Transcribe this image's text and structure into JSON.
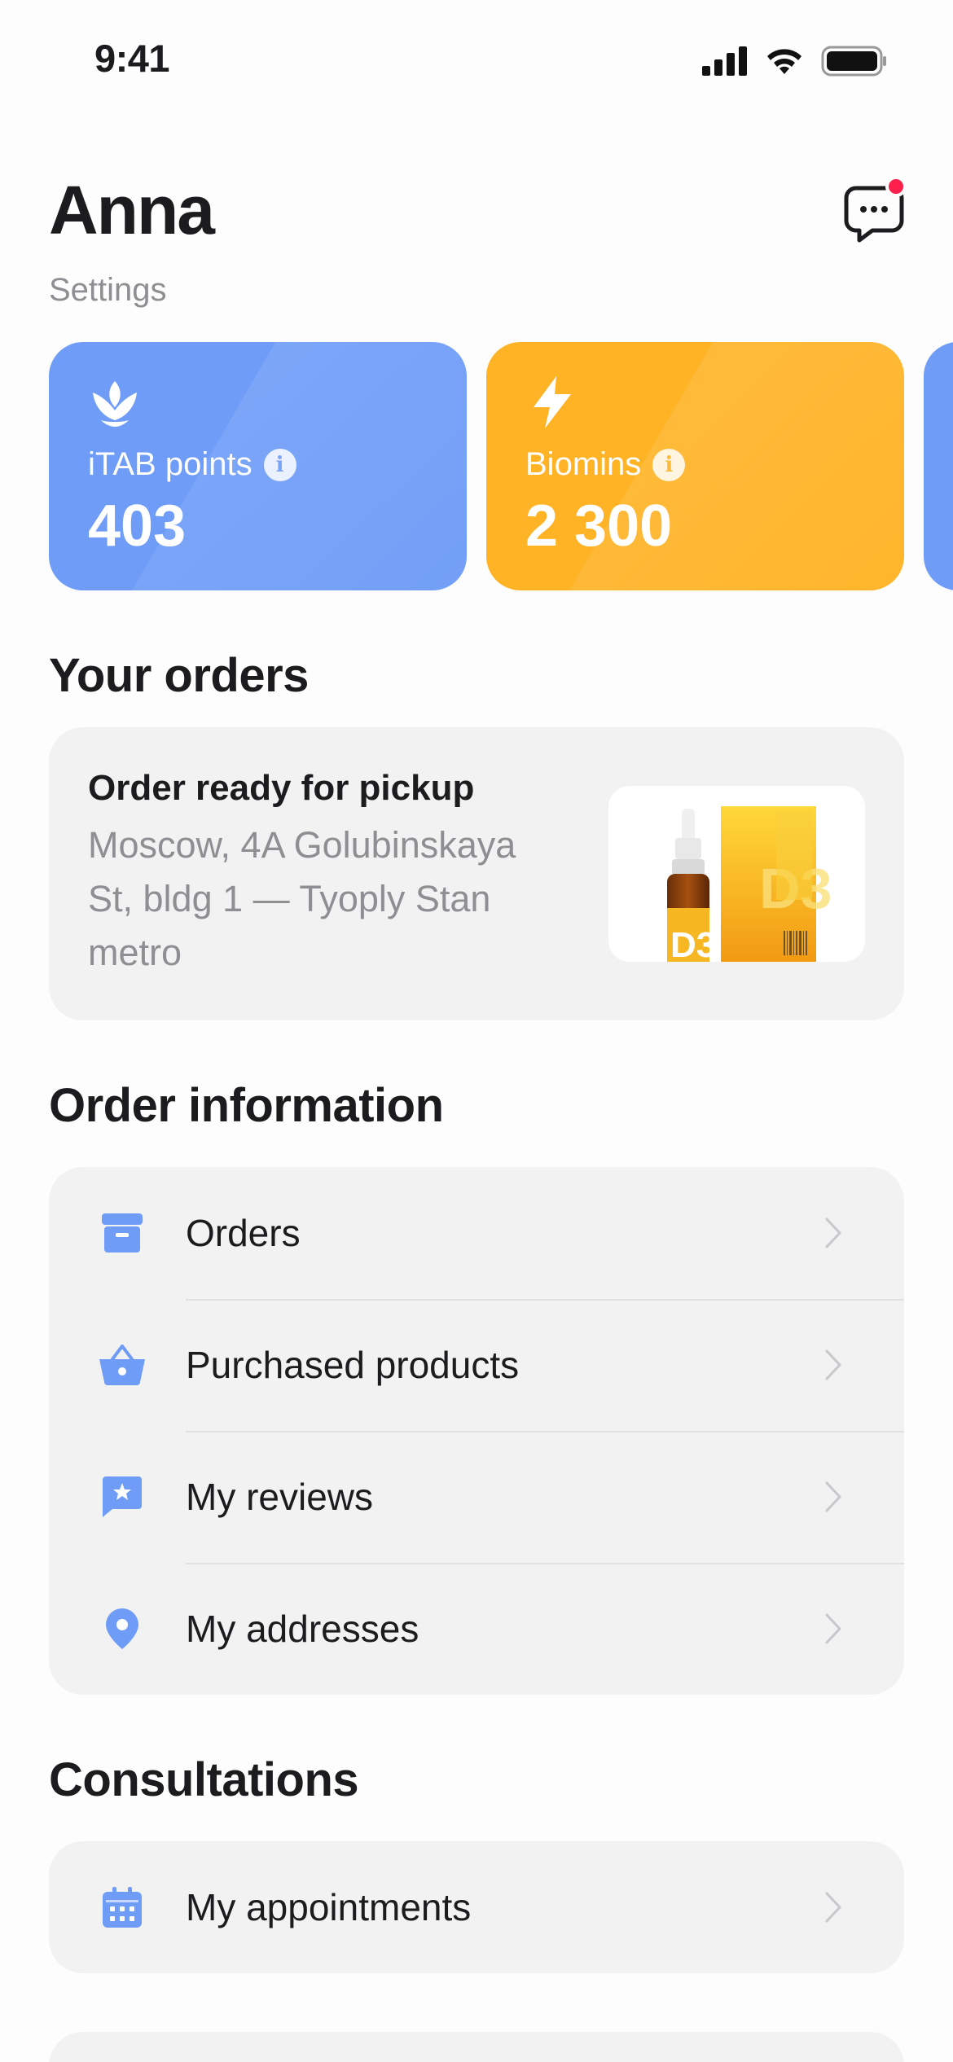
{
  "status_bar": {
    "time": "9:41"
  },
  "header": {
    "name": "Anna",
    "subtitle": "Settings"
  },
  "points_cards": [
    {
      "label": "iTAB points",
      "value": "403",
      "icon": "flower-icon",
      "color": "#6e9cf7"
    },
    {
      "label": "Biomins",
      "value": "2 300",
      "icon": "lightning-icon",
      "color": "#ffb325"
    }
  ],
  "your_orders": {
    "title": "Your orders",
    "order": {
      "status": "Order ready for pickup",
      "address": "Moscow, 4A Golubinskaya St, bldg 1 — Tyoply Stan metro"
    }
  },
  "order_information": {
    "title": "Order information",
    "items": [
      {
        "label": "Orders",
        "icon": "archive-box-icon"
      },
      {
        "label": "Purchased products",
        "icon": "basket-icon"
      },
      {
        "label": "My reviews",
        "icon": "review-star-icon"
      },
      {
        "label": "My addresses",
        "icon": "location-pin-icon"
      }
    ]
  },
  "consultations": {
    "title": "Consultations",
    "items": [
      {
        "label": "My appointments",
        "icon": "calendar-icon"
      }
    ]
  },
  "colors": {
    "accent": "#6e9cf7",
    "orange": "#ffb325",
    "notification": "#ff1f4b",
    "secondary_text": "#8e8e93"
  }
}
